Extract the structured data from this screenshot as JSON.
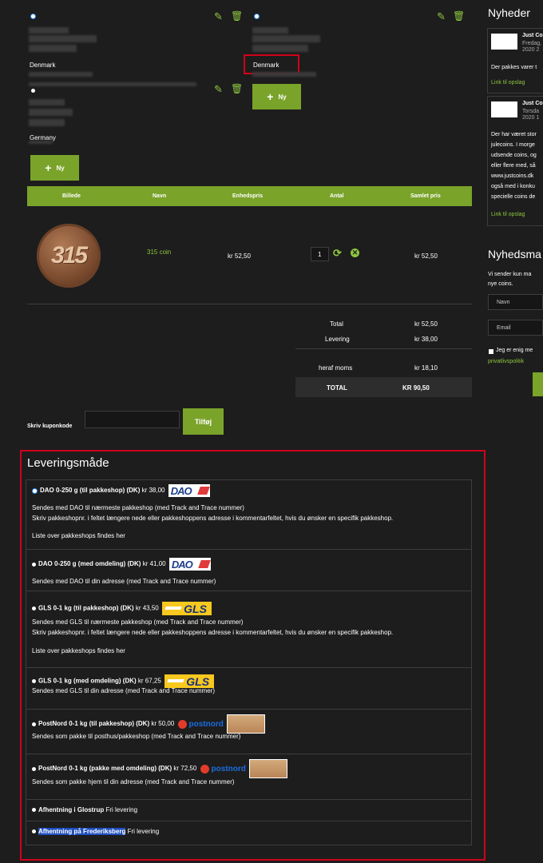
{
  "addresses": [
    {
      "country": "Denmark"
    },
    {
      "country": "Denmark"
    },
    {
      "country": "Germany"
    }
  ],
  "new_button_label": "Ny",
  "cart": {
    "headers": [
      "Billede",
      "Navn",
      "Enhedspris",
      "Antal",
      "Samlet pris"
    ],
    "item": {
      "coin_text": "315",
      "name": "315 coin",
      "unit_price": "kr 52,50",
      "quantity": "1",
      "total": "kr 52,50"
    },
    "summary": [
      {
        "label": "Total",
        "value": "kr 52,50"
      },
      {
        "label": "Levering",
        "value": "kr 38,00"
      },
      {
        "label": "heraf moms",
        "value": "kr 18,10"
      }
    ],
    "grand_total": {
      "label": "TOTAL",
      "value": "KR 90,50"
    }
  },
  "coupon": {
    "label": "Skriv kuponkode",
    "value": "",
    "button": "Tilføj"
  },
  "delivery": {
    "title": "Leveringsmåde",
    "options": [
      {
        "name": "DAO 0-250 g (til pakkeshop) (DK)",
        "price": "kr 38,00",
        "logo": "DAO",
        "lines": [
          "Sendes med DAO til nærmeste pakkeshop (med Track and Trace nummer)",
          "Skriv pakkeshopnr. i feltet længere nede eller pakkeshoppens adresse i kommentarfeltet, hvis du ønsker en specifik pakkeshop."
        ],
        "link": "Liste over pakkeshops findes her"
      },
      {
        "name": "DAO 0-250 g (med omdeling) (DK)",
        "price": "kr 41,00",
        "logo": "DAO",
        "lines": [
          "Sendes med DAO til din adresse (med Track and Trace nummer)"
        ]
      },
      {
        "name": "GLS 0-1 kg (til pakkeshop) (DK)",
        "price": "kr 43,50",
        "logo": "GLS",
        "lines": [
          "Sendes med GLS til nærmeste pakkeshop (med Track and Trace nummer)",
          "Skriv pakkeshopnr. i feltet længere nede eller pakkeshoppens adresse i kommentarfeltet, hvis du ønsker en specifik pakkeshop."
        ],
        "link": "Liste over pakkeshops findes her"
      },
      {
        "name": "GLS 0-1 kg (med omdeling) (DK)",
        "price": "kr 67,25",
        "logo": "GLS",
        "lines": [
          "Sendes med GLS til din adresse (med Track and Trace nummer)"
        ]
      },
      {
        "name": "PostNord 0-1 kg (til pakkeshop) (DK)",
        "price": "kr 50,00",
        "logo": "postnord",
        "lines": [
          "Sendes som pakke til posthus/pakkeshop (med Track and Trace nummer)"
        ]
      },
      {
        "name": "PostNord 0-1 kg (pakke med omdeling) (DK)",
        "price": "kr 72,50",
        "logo": "postnord",
        "lines": [
          "Sendes som pakke hjem til din adresse (med Track and Trace nummer)"
        ]
      },
      {
        "name": "Afhentning i Glostrup",
        "price": "Fri levering"
      },
      {
        "name": "Afhentning på Frederiksberg",
        "price": "Fri levering"
      }
    ]
  },
  "sidebar": {
    "news_title": "Nyheder",
    "news": [
      {
        "source": "Just Co",
        "date1": "Fredag,",
        "date2": "2020 2",
        "text": [
          "Der pakkes varer t"
        ],
        "link": "Link til opslag"
      },
      {
        "source": "Just Co",
        "date1": "Torsda",
        "date2": "2020 1",
        "text": [
          "Der har været stor",
          "julecoins. I morge",
          "udsende coins, og",
          "eller flere med, så",
          "www.justcoins.dk",
          "også med i konku",
          "specielle coins de"
        ],
        "link": "Link til opslag"
      }
    ],
    "newsletter_title": "Nyhedsma",
    "newsletter_text": [
      "Vi sender kun ma",
      "nye coins."
    ],
    "name_placeholder": "Navn",
    "email_placeholder": "Email",
    "consent": "Jeg er enig me",
    "privacy_link": "privatlivspolitik"
  },
  "colors": {
    "accent": "#7aa32a",
    "link": "#8dc63f",
    "highlight": "#d0021b"
  }
}
